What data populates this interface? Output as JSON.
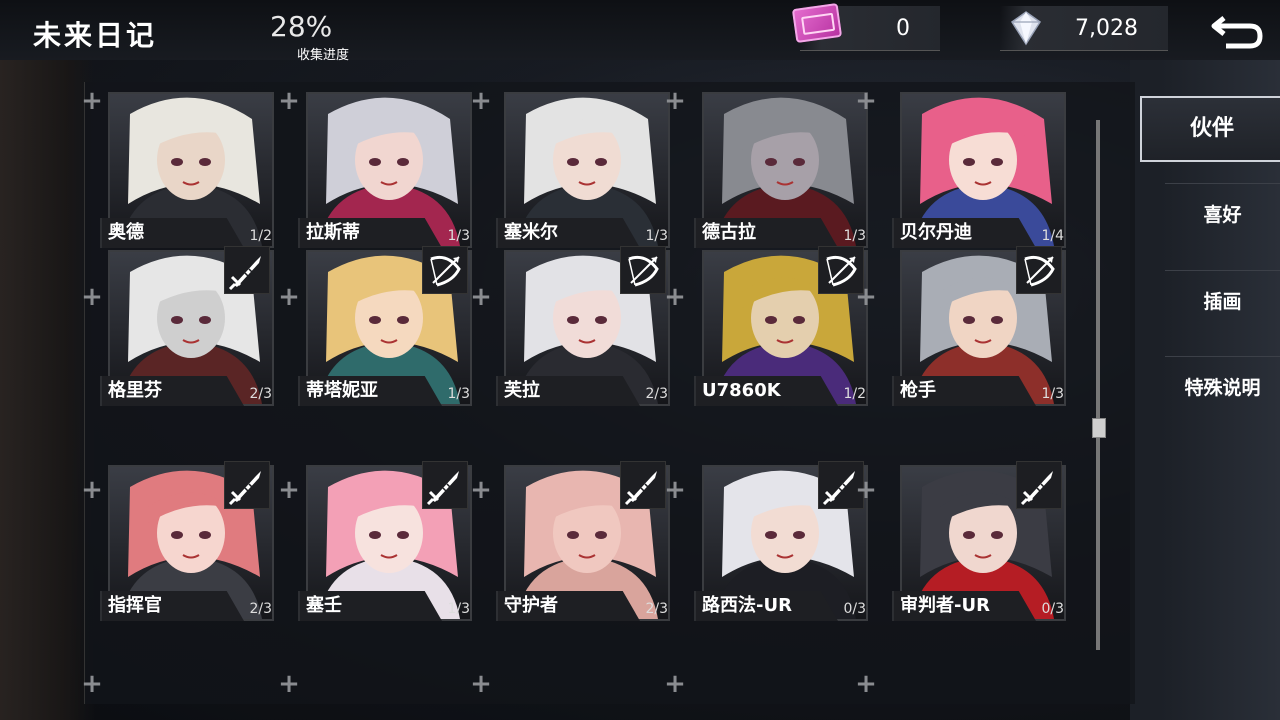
{
  "header": {
    "title": "未来日记",
    "progress_value": "28%",
    "progress_label": "收集进度",
    "ticket_count": "0",
    "gem_count": "7,028"
  },
  "tabs": [
    {
      "label": "伙伴",
      "active": true
    },
    {
      "label": "喜好",
      "active": false
    },
    {
      "label": "插画",
      "active": false
    },
    {
      "label": "特殊说明",
      "active": false
    }
  ],
  "scroll_position_fraction": 0.58,
  "characters": [
    {
      "name": "奥德",
      "count": "1/2",
      "weapon": null,
      "hair": "#e8e6df",
      "skin": "#e9d6c8",
      "cloth": "#2b2d33"
    },
    {
      "name": "拉斯蒂",
      "count": "1/3",
      "weapon": null,
      "hair": "#cfcfd8",
      "skin": "#f1d6d0",
      "cloth": "#a3264f"
    },
    {
      "name": "塞米尔",
      "count": "1/3",
      "weapon": null,
      "hair": "#e3e3e3",
      "skin": "#f0dcd3",
      "cloth": "#2a2f36"
    },
    {
      "name": "德古拉",
      "count": "1/3",
      "weapon": null,
      "hair": "#888a90",
      "skin": "#a7a0a8",
      "cloth": "#5a1a20"
    },
    {
      "name": "贝尔丹迪",
      "count": "1/4",
      "weapon": null,
      "hair": "#e8608a",
      "skin": "#f7ddd5",
      "cloth": "#3a4a9a"
    },
    {
      "name": "格里芬",
      "count": "2/3",
      "weapon": "sword",
      "hair": "#e6e6e6",
      "skin": "#cfcfcf",
      "cloth": "#5a2525"
    },
    {
      "name": "蒂塔妮亚",
      "count": "1/3",
      "weapon": "bow",
      "hair": "#e8c47a",
      "skin": "#f5d9bf",
      "cloth": "#2f6b6b"
    },
    {
      "name": "芙拉",
      "count": "2/3",
      "weapon": "bow",
      "hair": "#e2e2e6",
      "skin": "#f1dcd8",
      "cloth": "#2a2b31"
    },
    {
      "name": "U7860K",
      "count": "1/2",
      "weapon": "bow",
      "hair": "#c9a73a",
      "skin": "#e4cfae",
      "cloth": "#4a2b7a"
    },
    {
      "name": "枪手",
      "count": "1/3",
      "weapon": "bow",
      "hair": "#a9adb5",
      "skin": "#f0d5c4",
      "cloth": "#8d2f2a"
    },
    {
      "name": "指挥官",
      "count": "2/3",
      "weapon": "sword",
      "hair": "#e07b7f",
      "skin": "#f6d6cf",
      "cloth": "#3b3d44"
    },
    {
      "name": "塞壬",
      "count": "1/3",
      "weapon": "sword",
      "hair": "#f3a0b6",
      "skin": "#f7e2de",
      "cloth": "#e8e0e8"
    },
    {
      "name": "守护者",
      "count": "2/3",
      "weapon": "sword",
      "hair": "#e8b6b0",
      "skin": "#f0c8c0",
      "cloth": "#d9a49c"
    },
    {
      "name": "路西法-UR",
      "count": "0/3",
      "weapon": "sword",
      "hair": "#e4e4ea",
      "skin": "#f2dcd3",
      "cloth": "#1d1e24"
    },
    {
      "name": "审判者-UR",
      "count": "0/3",
      "weapon": "sword",
      "hair": "#3b3c44",
      "skin": "#f0d7cf",
      "cloth": "#b51d24"
    }
  ]
}
